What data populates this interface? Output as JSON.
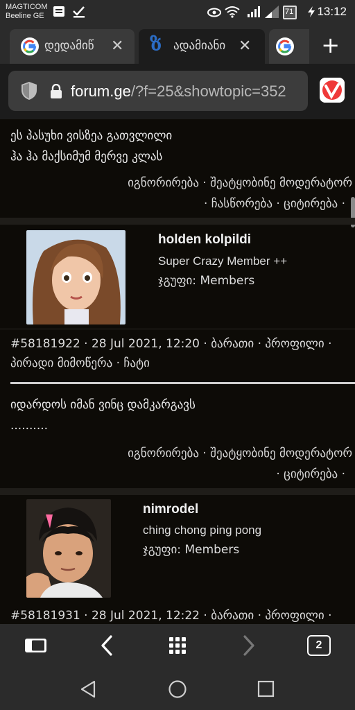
{
  "status": {
    "carrier_line1": "MAGTICOM",
    "carrier_line2": "Beeline GE",
    "battery": "71",
    "time": "13:12"
  },
  "tabs": [
    {
      "title": "დედამიწ",
      "favicon": "google-icon"
    },
    {
      "title": "ადამიანი",
      "favicon": "forum-ge-icon",
      "active": true
    },
    {
      "title": "",
      "favicon": "google-icon"
    }
  ],
  "url": {
    "host": "forum.ge",
    "path": "/?f=25&showtopic=352"
  },
  "open_tabs_count": "2",
  "posts": {
    "prev_post": {
      "line1": "ეს პასუხი ვისზეა გათვლილი",
      "line2": "ჰა ჰა მაქსიმუმ მერვე კლას",
      "actions_line1": "იგნორირება · შეატყობინე მოდერატორ",
      "actions_line2": "· ჩასწორება · ციტირება ·"
    },
    "post1": {
      "username": "holden kolpildi",
      "title": "Super Crazy Member ++",
      "group": "ჯგუფი: Members",
      "meta_line1": "#58181922 · 28 Jul 2021, 12:20 · ბარათი · პროფილი ·",
      "meta_line2": "პირადი მიმოწერა · ჩატი",
      "body_line1": "იდარდოს იმან ვინც დამკარგავს",
      "body_line2": "..........",
      "actions_line1": "იგნორირება · შეატყობინე მოდერატორ",
      "actions_line2": "· ციტირება ·"
    },
    "post2": {
      "username": "nimrodel",
      "title": "ching chong ping pong",
      "group": "ჯგუფი: Members",
      "meta_line1": "#58181931 · 28 Jul 2021, 12:22 · ბარათი · პროფილი ·"
    }
  }
}
